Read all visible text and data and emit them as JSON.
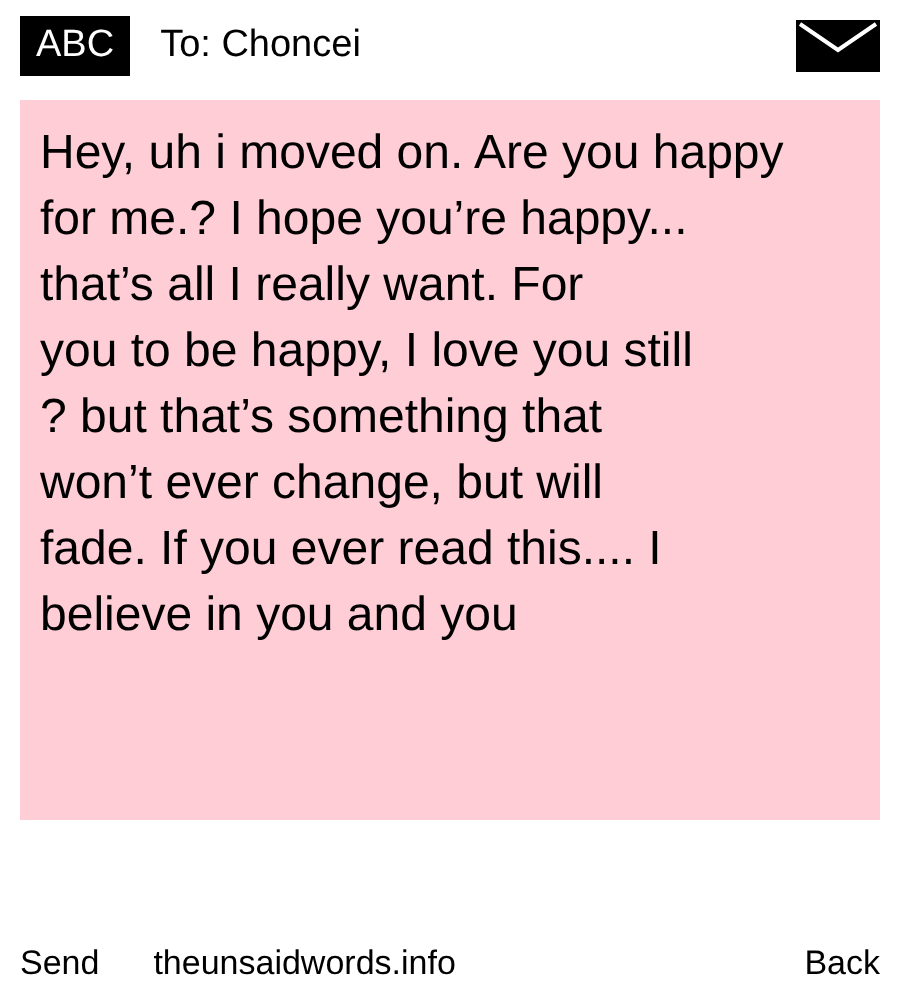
{
  "header": {
    "badge": "ABC",
    "recipient": "To: Choncei"
  },
  "message": "Hey, uh i moved on. Are you happy\nfor me.? I hope you’re happy...\nthat’s all I really want. For\nyou to be happy, I love you still\n? but that’s something that\nwon’t ever change, but will\nfade. If you ever read this.... I\nbelieve in you and you",
  "footer": {
    "left": "Send",
    "center": "theunsaidwords.info",
    "right": "Back"
  }
}
